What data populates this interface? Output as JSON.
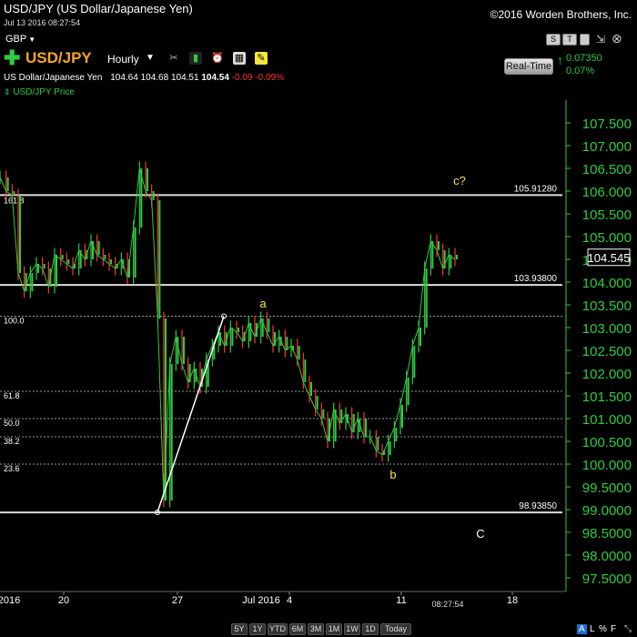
{
  "header": {
    "title": "USD/JPY (US Dollar/Japanese Yen)",
    "copyright": "©2016 Worden Brothers, Inc.",
    "timestamp": "Jul 13 2016 08:27:54",
    "currency": "GBP"
  },
  "toolbar": {
    "symbol": "USD/JPY",
    "period": "Hourly",
    "realtime_label": "Real-Time",
    "change_abs": "0.07350",
    "change_pct": "0.07%",
    "window_buttons": [
      "S",
      "T",
      "",
      "",
      ""
    ]
  },
  "quote": {
    "name": "US Dollar/Japanese Yen",
    "open": "104.64",
    "high": "104.68",
    "low": "104.51",
    "close": "104.54",
    "change": "-0.09",
    "change_pct": "-0.09%"
  },
  "price_label": "USD/JPY Price",
  "colors": {
    "green": "#2ecc40",
    "yellow": "#f5e63a",
    "orange": "#f5a623",
    "red": "#ff3333"
  },
  "chart_data": {
    "type": "candlestick",
    "title": "USD/JPY Price",
    "y_ticks": [
      "107.500",
      "107.000",
      "106.500",
      "106.000",
      "105.500",
      "105.000",
      "104.500",
      "104.000",
      "103.500",
      "103.000",
      "102.500",
      "102.000",
      "101.500",
      "101.000",
      "100.500",
      "100.000",
      "99.5000",
      "99.0000",
      "98.5000",
      "98.0000",
      "97.5000"
    ],
    "ylim": [
      97.2,
      107.9
    ],
    "x_ticks": [
      "2016",
      "20",
      "27",
      "Jul 2016",
      "4",
      "11",
      "18"
    ],
    "last_price": "104.545",
    "clock": "08:27:54",
    "levels": [
      {
        "value": 105.9128,
        "label": "105.91280",
        "style": "solid"
      },
      {
        "value": 103.938,
        "label": "103.93800",
        "style": "solid"
      },
      {
        "value": 98.9385,
        "label": "98.93850",
        "style": "solid"
      },
      {
        "value": 103.25,
        "label": "100.0",
        "style": "dotted"
      },
      {
        "value": 101.6,
        "label": "61.8",
        "style": "dotted"
      },
      {
        "value": 101.0,
        "label": "50.0",
        "style": "dotted"
      },
      {
        "value": 100.6,
        "label": "38.2",
        "style": "dotted"
      },
      {
        "value": 100.0,
        "label": "23.6",
        "style": "dotted"
      }
    ],
    "fib_top_label": "161.8",
    "wave_labels": [
      "a",
      "b",
      "c?",
      "C"
    ],
    "series": [
      {
        "values": [
          106.3,
          106.0,
          105.9,
          104.2,
          103.8,
          104.2,
          104.4,
          104.3,
          103.9,
          104.6,
          104.5,
          104.4,
          104.3,
          104.7,
          104.5,
          104.9,
          104.6,
          104.5,
          104.4,
          104.3,
          104.5,
          104.1,
          105.2,
          106.5,
          106.0,
          105.8,
          103.2,
          99.2,
          102.2,
          102.8,
          102.2,
          101.8,
          102.1,
          101.7,
          102.3,
          102.6,
          102.9,
          102.6,
          103.0,
          102.9,
          102.7,
          103.1,
          102.8,
          103.2,
          102.9,
          102.6,
          102.8,
          102.5,
          102.6,
          102.3,
          101.8,
          101.5,
          101.2,
          101.0,
          100.5,
          101.2,
          100.9,
          101.1,
          100.7,
          101.0,
          100.6,
          100.6,
          100.3,
          100.2,
          100.5,
          100.8,
          101.3,
          101.9,
          102.6,
          103.0,
          104.3,
          104.9,
          104.7,
          104.3,
          104.6,
          104.5
        ]
      }
    ],
    "trendline": {
      "from": [
        25.5,
        98.94
      ],
      "to": [
        29.2,
        103.25
      ]
    }
  },
  "timeframes": [
    "5Y",
    "1Y",
    "YTD",
    "6M",
    "3M",
    "1M",
    "1W",
    "1D",
    "Today"
  ],
  "bottom_right": [
    "A",
    "L",
    "%",
    "F"
  ]
}
